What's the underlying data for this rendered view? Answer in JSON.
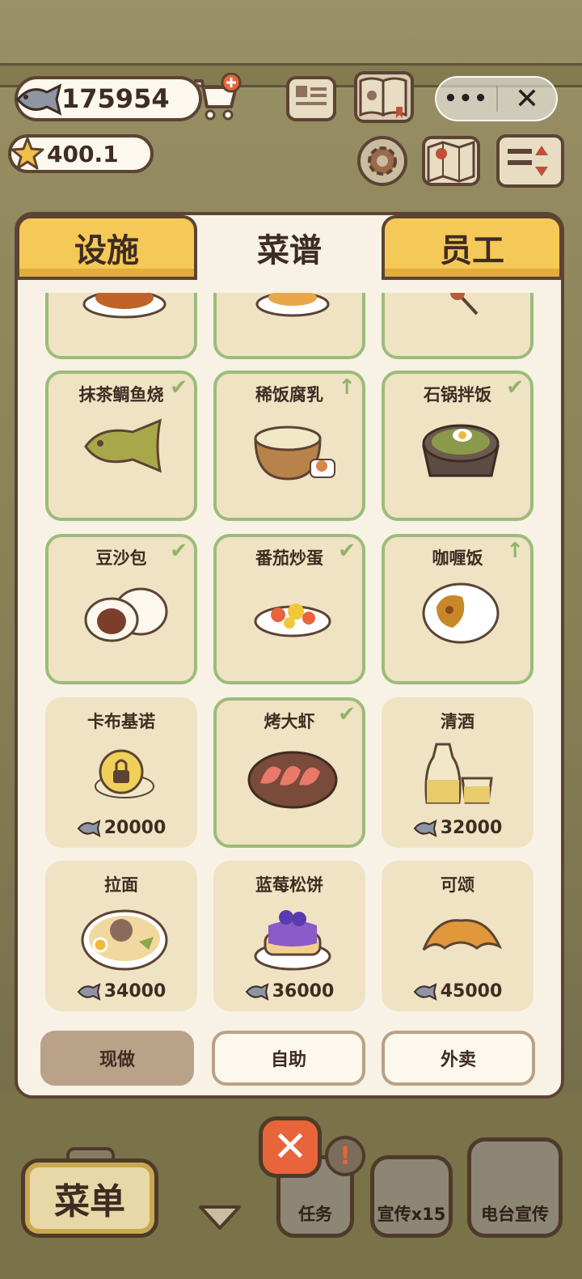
{
  "hud": {
    "fish_count": "175954",
    "star_rating": "400.1"
  },
  "capsule": {
    "more_label": "•••",
    "close_label": "✕"
  },
  "tabs": [
    {
      "label": "设施",
      "active": false
    },
    {
      "label": "菜谱",
      "active": true
    },
    {
      "label": "员工",
      "active": false
    }
  ],
  "recipes": [
    {
      "name": "",
      "status": "unlocked",
      "mark": ""
    },
    {
      "name": "",
      "status": "unlocked",
      "mark": ""
    },
    {
      "name": "",
      "status": "unlocked",
      "mark": ""
    },
    {
      "name": "抹茶鲷鱼烧",
      "status": "unlocked",
      "mark": "✔"
    },
    {
      "name": "稀饭腐乳",
      "status": "unlocked",
      "mark": "↑"
    },
    {
      "name": "石锅拌饭",
      "status": "unlocked",
      "mark": "✔"
    },
    {
      "name": "豆沙包",
      "status": "unlocked",
      "mark": "✔"
    },
    {
      "name": "番茄炒蛋",
      "status": "unlocked",
      "mark": "✔"
    },
    {
      "name": "咖喱饭",
      "status": "unlocked",
      "mark": "↑"
    },
    {
      "name": "卡布基诺",
      "status": "locked",
      "price": "20000"
    },
    {
      "name": "烤大虾",
      "status": "unlocked",
      "mark": "✔"
    },
    {
      "name": "清酒",
      "status": "locked",
      "price": "32000"
    },
    {
      "name": "拉面",
      "status": "locked",
      "price": "34000"
    },
    {
      "name": "蓝莓松饼",
      "status": "locked",
      "price": "36000"
    },
    {
      "name": "可颂",
      "status": "locked",
      "price": "45000"
    }
  ],
  "modes": [
    {
      "label": "现做",
      "selected": true
    },
    {
      "label": "自助",
      "selected": false
    },
    {
      "label": "外卖",
      "selected": false
    }
  ],
  "bottom_bar": {
    "menu_label": "菜单",
    "task_label": "任务",
    "promo_label": "宣传x15",
    "radio_label": "电台宣传",
    "alert_label": "!",
    "close_label": "✕"
  },
  "colors": {
    "card_border_unlocked": "#9dbc78",
    "tab_inactive": "#f5c957",
    "panel_bg": "#f8f2e6",
    "outline": "#5c4334"
  }
}
